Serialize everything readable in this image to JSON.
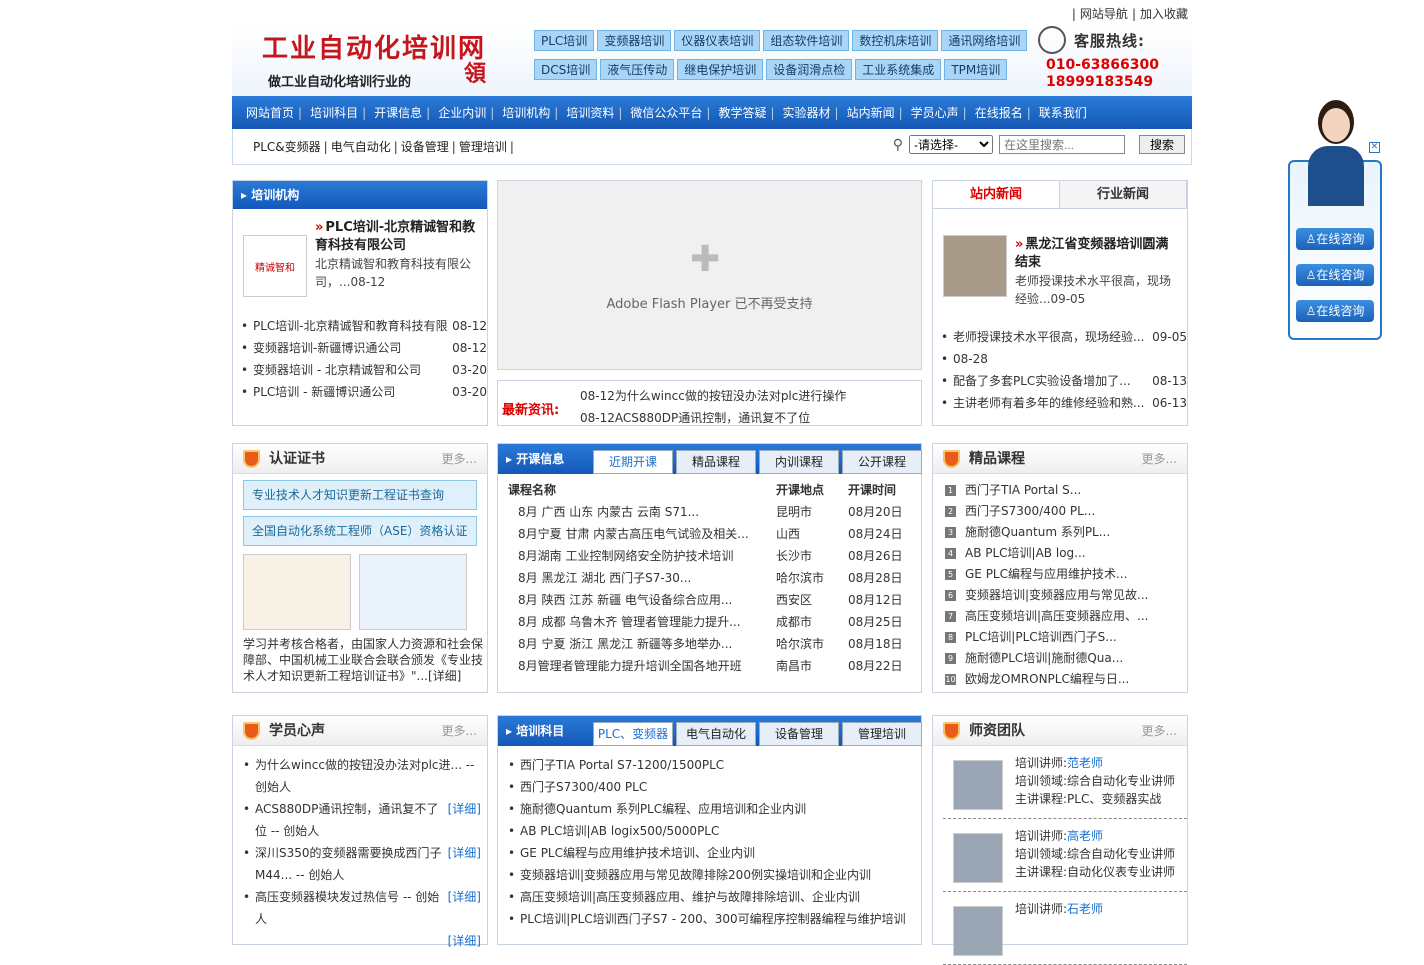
{
  "toplinks": {
    "sitemap": "网站导航",
    "favorite": "加入收藏"
  },
  "logo": {
    "title": "工业自动化培训网",
    "sub": "做工业自动化培训行业的",
    "seal": "领跑"
  },
  "hnav": {
    "row1": [
      "PLC培训",
      "变频器培训",
      "仪器仪表培训",
      "组态软件培训",
      "数控机床培训",
      "通讯网络培训"
    ],
    "row2": [
      "DCS培训",
      "液气压传动",
      "继电保护培训",
      "设备润滑点检",
      "工业系统集成",
      "TPM培训"
    ]
  },
  "hotline": {
    "label": "客服热线:",
    "num1": "010-63866300",
    "num2": "18999183549"
  },
  "mainnav": [
    "网站首页",
    "培训科目",
    "开课信息",
    "企业内训",
    "培训机构",
    "培训资料",
    "微信公众平台",
    "教学答疑",
    "实验器材",
    "站内新闻",
    "学员心声",
    "在线报名",
    "联系我们"
  ],
  "subnav": [
    "PLC&变频器",
    "电气自动化",
    "设备管理",
    "管理培训"
  ],
  "search": {
    "select": "-请选择-",
    "placeholder": "在这里搜索...",
    "button": "搜索"
  },
  "org": {
    "header": "培训机构",
    "feat_title": "PLC培训-北京精诚智和教育科技有限公司",
    "feat_desc": "北京精诚智和教育科技有限公司，...08-12",
    "items": [
      {
        "t": "PLC培训-北京精诚智和教育科技有限公司",
        "d": "08-12"
      },
      {
        "t": "变频器培训-新疆博识通公司",
        "d": "08-12"
      },
      {
        "t": "变频器培训 - 北京精诚智和公司",
        "d": "03-20"
      },
      {
        "t": "PLC培训 - 新疆博识通公司",
        "d": "03-20"
      }
    ]
  },
  "flash": {
    "msg": "Adobe Flash Player 已不再受支持",
    "latest_label": "最新资讯:",
    "latest": [
      "08-12为什么wincc做的按钮没办法对plc进行操作",
      "08-12ACS880DP通讯控制，通讯复不了位"
    ]
  },
  "news": {
    "tab1": "站内新闻",
    "tab2": "行业新闻",
    "feat_title": "黑龙江省变频器培训圆满结束",
    "feat_desc": "老师授课技术水平很高，现场经验...09-05",
    "items": [
      {
        "t": "老师授课技术水平很高，现场经验...",
        "d": "09-05"
      },
      {
        "t": "08-28",
        "d": ""
      },
      {
        "t": "配备了多套PLC实验设备增加了...",
        "d": "08-13"
      },
      {
        "t": "主讲老师有着多年的维修经验和熟...",
        "d": "06-13"
      }
    ]
  },
  "cert": {
    "header": "认证证书",
    "more": "更多...",
    "btn1": "专业技术人才知识更新工程证书查询",
    "btn2": "全国自动化系统工程师（ASE）资格认证",
    "desc": "学习并考核合格者，由国家人力资源和社会保障部、中国机械工业联合会联合颁发《专业技术人才知识更新工程培训证书》\"...[详细]"
  },
  "course": {
    "header": "开课信息",
    "tabs": [
      "近期开课",
      "精品课程",
      "内训课程",
      "公开课程"
    ],
    "cols": [
      "课程名称",
      "开课地点",
      "开课时间"
    ],
    "rows": [
      [
        "8月 广西 山东 内蒙古 云南 S71...",
        "昆明市",
        "08月20日"
      ],
      [
        "8月宁夏 甘肃 内蒙古高压电气试验及相关...",
        "山西",
        "08月24日"
      ],
      [
        "8月湖南 工业控制网络安全防护技术培训",
        "长沙市",
        "08月26日"
      ],
      [
        "8月 黑龙江 湖北 西门子S7-30...",
        "哈尔滨市",
        "08月28日"
      ],
      [
        "8月 陕西 江苏 新疆 电气设备综合应用...",
        "西安区",
        "08月12日"
      ],
      [
        "8月 成都 乌鲁木齐 管理者管理能力提升...",
        "成都市",
        "08月25日"
      ],
      [
        "8月 宁夏 浙江 黑龙江 新疆等多地举办...",
        "哈尔滨市",
        "08月18日"
      ],
      [
        "8月管理者管理能力提升培训全国各地开班",
        "南昌市",
        "08月22日"
      ]
    ]
  },
  "quality": {
    "header": "精品课程",
    "more": "更多...",
    "items": [
      "西门子TIA Portal S...",
      "西门子S7300/400 PL...",
      "施耐德Quantum 系列PL...",
      "AB PLC培训|AB log...",
      "GE PLC编程与应用维护技术...",
      "变频器培训|变频器应用与常见故...",
      "高压变频培训|高压变频器应用、...",
      "PLC培训|PLC培训西门子S...",
      "施耐德PLC培训|施耐德Qua...",
      "欧姆龙OMRONPLC编程与日..."
    ]
  },
  "voice": {
    "header": "学员心声",
    "more": "更多...",
    "detail": "[详细]",
    "items": [
      "为什么wincc做的按钮没办法对plc进... -- 创始人",
      "ACS880DP通讯控制，通讯复不了位 -- 创始人",
      "深川S350的变频器需要换成西门子M44... -- 创始人",
      "高压变频器模块发过热信号 -- 创始人"
    ]
  },
  "subject": {
    "header": "培训科目",
    "tabs": [
      "PLC、变频器",
      "电气自动化",
      "设备管理",
      "管理培训"
    ],
    "items": [
      "西门子TIA Portal S7-1200/1500PLC",
      "西门子S7300/400 PLC",
      "施耐德Quantum 系列PLC编程、应用培训和企业内训",
      "AB PLC培训|AB logix500/5000PLC",
      "GE PLC编程与应用维护技术培训、企业内训",
      "变频器培训|变频器应用与常见故障排除200例实操培训和企业内训",
      "高压变频培训|高压变频器应用、维护与故障排除培训、企业内训",
      "PLC培训|PLC培训西门子S7 - 200、300可编程序控制器编程与维护培训"
    ]
  },
  "teachers": {
    "header": "师资团队",
    "more": "更多...",
    "label_name": "培训讲师:",
    "label_field": "培训领域:",
    "label_course": "主讲课程:",
    "list": [
      {
        "name": "范老师",
        "field": "综合自动化专业讲师",
        "course": "PLC、变频器实战"
      },
      {
        "name": "高老师",
        "field": "综合自动化专业讲师",
        "course": "自动化仪表专业讲师"
      },
      {
        "name": "石老师",
        "field": "",
        "course": ""
      }
    ]
  },
  "float": {
    "btn": "在线咨询"
  },
  "colors": {
    "nav_blue": "#1a66c4",
    "accent_red": "#c4161c"
  }
}
